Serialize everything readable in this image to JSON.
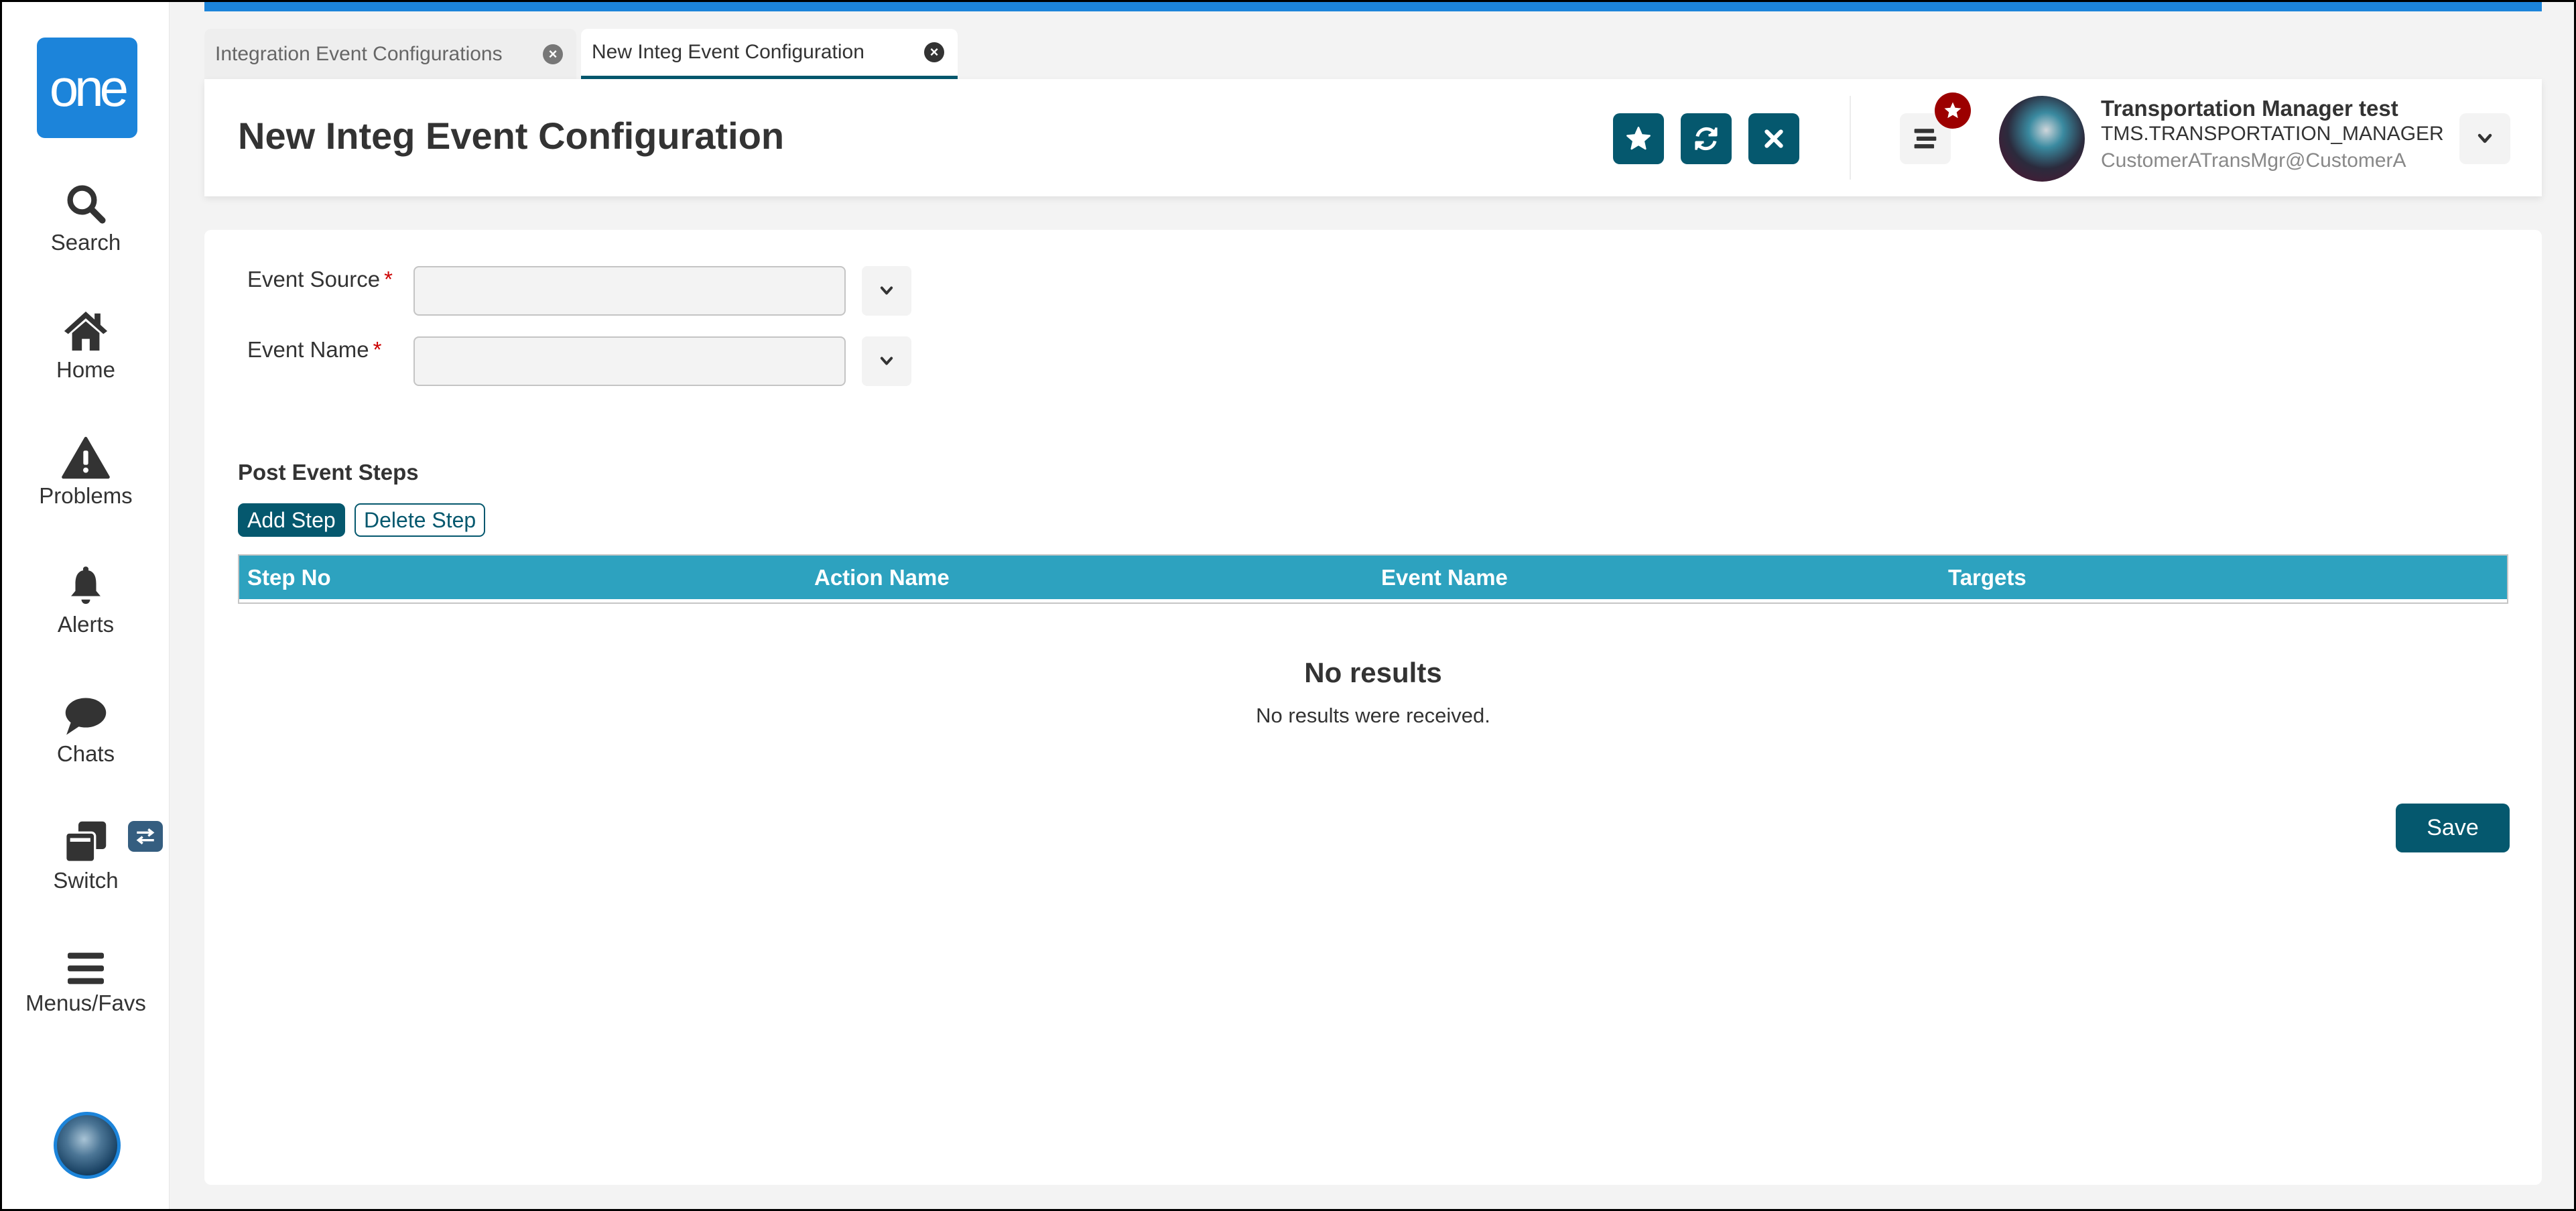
{
  "sidebar": {
    "logo_text": "one",
    "items": [
      {
        "label": "Search",
        "icon": "search-icon"
      },
      {
        "label": "Home",
        "icon": "home-icon"
      },
      {
        "label": "Problems",
        "icon": "warning-icon"
      },
      {
        "label": "Alerts",
        "icon": "bell-icon"
      },
      {
        "label": "Chats",
        "icon": "chat-icon"
      },
      {
        "label": "Switch",
        "icon": "window-switch-icon"
      },
      {
        "label": "Menus/Favs",
        "icon": "hamburger-icon"
      }
    ],
    "switch_badge_icon": "exchange-arrows-icon",
    "avatar_icon": "user-avatar"
  },
  "tabs": [
    {
      "label": "Integration Event Configurations",
      "active": false
    },
    {
      "label": "New Integ Event Configuration",
      "active": true
    }
  ],
  "header": {
    "title": "New Integ Event Configuration",
    "actions": [
      {
        "name": "favorite",
        "icon": "star-icon"
      },
      {
        "name": "refresh",
        "icon": "refresh-icon"
      },
      {
        "name": "close",
        "icon": "close-icon"
      }
    ],
    "menu_icon": "align-center-icon",
    "menu_badge_icon": "star-icon",
    "user": {
      "name": "Transportation Manager test",
      "role": "TMS.TRANSPORTATION_MANAGER",
      "email": "CustomerATransMgr@CustomerA"
    }
  },
  "form": {
    "fields": [
      {
        "label": "Event Source",
        "required_marker": "*",
        "value": "",
        "placeholder": ""
      },
      {
        "label": "Event Name",
        "required_marker": "*",
        "value": "",
        "placeholder": ""
      }
    ]
  },
  "steps": {
    "title": "Post Event Steps",
    "add_label": "Add Step",
    "delete_label": "Delete Step",
    "columns": [
      "Step No",
      "Action Name",
      "Event Name",
      "Targets"
    ],
    "rows": [],
    "empty_title": "No results",
    "empty_message": "No results were received."
  },
  "footer": {
    "save_label": "Save"
  },
  "colors": {
    "brand_blue": "#1c84da",
    "primary_teal": "#05586e",
    "grid_header": "#2da2bf",
    "required_red": "#cc0000",
    "badge_red": "#9c0000"
  }
}
